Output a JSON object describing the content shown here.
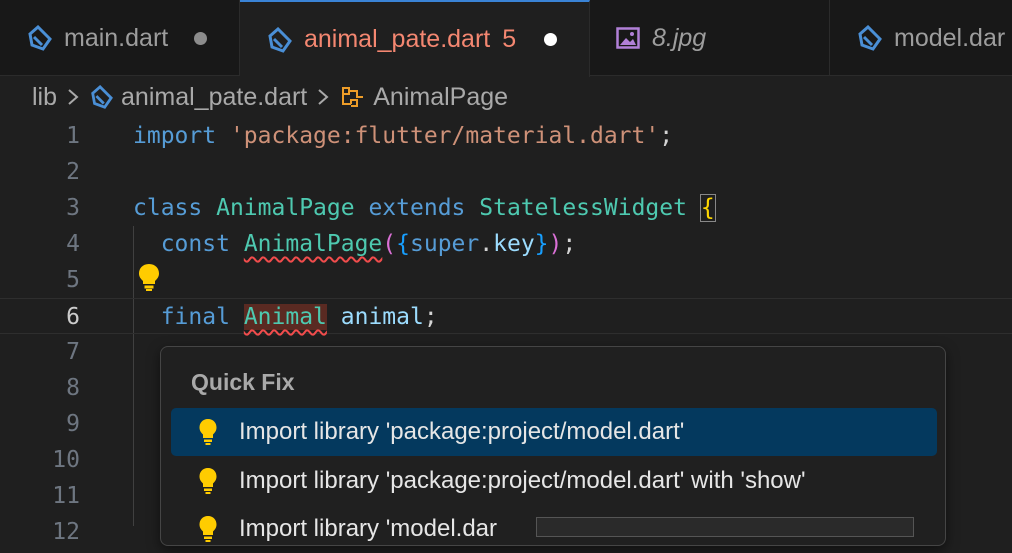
{
  "tabs": [
    {
      "label": "main.dart",
      "modified": true
    },
    {
      "label": "animal_pate.dart",
      "problems": "5",
      "modified": true,
      "active": true
    },
    {
      "label": "8.jpg"
    },
    {
      "label": "model.dar"
    }
  ],
  "breadcrumb": {
    "folder": "lib",
    "file": "animal_pate.dart",
    "symbol": "AnimalPage"
  },
  "code": {
    "line_numbers": [
      "1",
      "2",
      "3",
      "4",
      "5",
      "6",
      "7",
      "8",
      "9",
      "10",
      "11",
      "12"
    ],
    "l1": {
      "kw": "import",
      "str": "'package:flutter/material.dart'",
      "end": ";"
    },
    "l3": {
      "kw1": "class",
      "cls1": "AnimalPage",
      "kw2": "extends",
      "cls2": "StatelessWidget",
      "brace": "{"
    },
    "l4": {
      "kw": "const",
      "cls": "AnimalPage",
      "p1": "(",
      "b1": "{",
      "kw2": "super",
      "dot": ".",
      "var": "key",
      "b2": "}",
      "p2": ")",
      "end": ";"
    },
    "l6": {
      "kw": "final",
      "cls": "Animal",
      "var": "animal",
      "end": ";"
    }
  },
  "quick_fix": {
    "title": "Quick Fix",
    "items": [
      {
        "label": "Import library 'package:project/model.dart'",
        "selected": true
      },
      {
        "label": "Import library 'package:project/model.dart' with 'show'"
      },
      {
        "label": "Import library 'model.dar"
      }
    ]
  },
  "colors": {
    "accent": "#3a83d6",
    "selection": "#04395e",
    "error": "#f14c4c",
    "bulb": "#ffcc00",
    "dart": "#4a8fd6"
  }
}
